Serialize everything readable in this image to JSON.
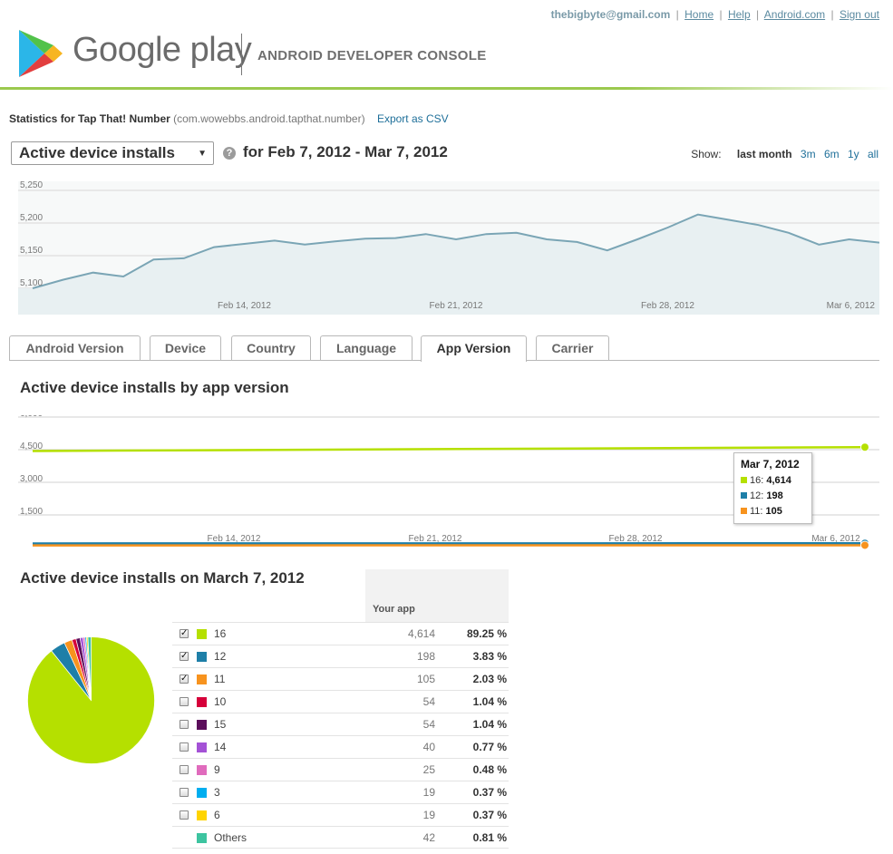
{
  "header": {
    "email": "thebigbyte@gmail.com",
    "links": [
      "Home",
      "Help",
      "Android.com",
      "Sign out"
    ],
    "brand": "Google play",
    "console_title": "ANDROID DEVELOPER CONSOLE",
    "accent_color": "#9bc94e"
  },
  "stats": {
    "label": "Statistics for Tap That! Number",
    "package": "(com.wowebbs.android.tapthat.number)",
    "export": "Export as CSV"
  },
  "controls": {
    "metric": "Active device installs",
    "help_icon": "question-icon",
    "date_range": "for Feb 7, 2012 - Mar 7, 2012",
    "show_label": "Show:",
    "ranges": [
      "last month",
      "3m",
      "6m",
      "1y",
      "all"
    ],
    "active_range": "last month"
  },
  "tabs": {
    "items": [
      "Android Version",
      "Device",
      "Country",
      "Language",
      "App Version",
      "Carrier"
    ],
    "active": "App Version"
  },
  "sections": {
    "by_version_title": "Active device installs by app version",
    "on_day_title": "Active device installs on March 7, 2012"
  },
  "tooltip": {
    "title": "Mar 7, 2012",
    "rows": [
      {
        "label": "16:",
        "value": "4,614",
        "color": "#b5e000"
      },
      {
        "label": "12:",
        "value": "198",
        "color": "#1e7fa8"
      },
      {
        "label": "11:",
        "value": "105",
        "color": "#f7931e"
      }
    ]
  },
  "table": {
    "header": "Your app",
    "rows": [
      {
        "version": "16",
        "count": "4,614",
        "percent": "89.25 %",
        "color": "#b5e000",
        "checkbox": true,
        "checked": true
      },
      {
        "version": "12",
        "count": "198",
        "percent": "3.83 %",
        "color": "#1e7fa8",
        "checkbox": true,
        "checked": true
      },
      {
        "version": "11",
        "count": "105",
        "percent": "2.03 %",
        "color": "#f7931e",
        "checkbox": true,
        "checked": true
      },
      {
        "version": "10",
        "count": "54",
        "percent": "1.04 %",
        "color": "#d6003a",
        "checkbox": true,
        "checked": false
      },
      {
        "version": "15",
        "count": "54",
        "percent": "1.04 %",
        "color": "#5b0e5b",
        "checkbox": true,
        "checked": false
      },
      {
        "version": "14",
        "count": "40",
        "percent": "0.77 %",
        "color": "#a452d6",
        "checkbox": true,
        "checked": false
      },
      {
        "version": "9",
        "count": "25",
        "percent": "0.48 %",
        "color": "#e06bbd",
        "checkbox": true,
        "checked": false
      },
      {
        "version": "3",
        "count": "19",
        "percent": "0.37 %",
        "color": "#00aef0",
        "checkbox": true,
        "checked": false
      },
      {
        "version": "6",
        "count": "19",
        "percent": "0.37 %",
        "color": "#ffd400",
        "checkbox": true,
        "checked": false
      },
      {
        "version": "Others",
        "count": "42",
        "percent": "0.81 %",
        "color": "#3dc4a0",
        "checkbox": false,
        "checked": false
      }
    ]
  },
  "chart_data": [
    {
      "type": "area",
      "x": [
        "Feb 7",
        "Feb 8",
        "Feb 9",
        "Feb 10",
        "Feb 11",
        "Feb 12",
        "Feb 13",
        "Feb 14",
        "Feb 15",
        "Feb 16",
        "Feb 17",
        "Feb 18",
        "Feb 19",
        "Feb 20",
        "Feb 21",
        "Feb 22",
        "Feb 23",
        "Feb 24",
        "Feb 25",
        "Feb 26",
        "Feb 27",
        "Feb 28",
        "Mar 1",
        "Mar 2",
        "Mar 3",
        "Mar 4",
        "Mar 5",
        "Mar 6",
        "Mar 7"
      ],
      "values": [
        5100,
        5113,
        5124,
        5118,
        5144,
        5146,
        5163,
        5168,
        5173,
        5167,
        5172,
        5176,
        5177,
        5183,
        5175,
        5183,
        5185,
        5175,
        5171,
        5158,
        5175,
        5193,
        5213,
        5205,
        5197,
        5185,
        5167,
        5175,
        5170
      ],
      "ylim": [
        5100,
        5250
      ],
      "y_ticks": [
        "5,250",
        "5,200",
        "5,150",
        "5,100"
      ],
      "x_ticks": [
        "Feb 14, 2012",
        "Feb 21, 2012",
        "Feb 28, 2012",
        "Mar 6, 2012"
      ],
      "grid": true,
      "line_color": "#7aa5b5",
      "fill_color": "#e8f0f2"
    },
    {
      "type": "line",
      "x": [
        "Feb 7",
        "Mar 7"
      ],
      "ylim": [
        0,
        6000
      ],
      "y_ticks": [
        "6,000",
        "4,500",
        "3,000",
        "1,500"
      ],
      "x_ticks": [
        "Feb 14, 2012",
        "Feb 21, 2012",
        "Feb 28, 2012",
        "Mar 6, 2012"
      ],
      "grid": true,
      "series": [
        {
          "name": "16",
          "values": [
            4440,
            4614
          ],
          "color": "#b5e000"
        },
        {
          "name": "12",
          "values": [
            190,
            198
          ],
          "color": "#1e7fa8"
        },
        {
          "name": "11",
          "values": [
            100,
            105
          ],
          "color": "#f7931e"
        }
      ]
    },
    {
      "type": "pie",
      "categories": [
        "16",
        "12",
        "11",
        "10",
        "15",
        "14",
        "9",
        "3",
        "6",
        "Others"
      ],
      "values": [
        4614,
        198,
        105,
        54,
        54,
        40,
        25,
        19,
        19,
        42
      ],
      "colors": [
        "#b5e000",
        "#1e7fa8",
        "#f7931e",
        "#d6003a",
        "#5b0e5b",
        "#a452d6",
        "#e06bbd",
        "#00aef0",
        "#ffd400",
        "#3dc4a0"
      ]
    }
  ]
}
